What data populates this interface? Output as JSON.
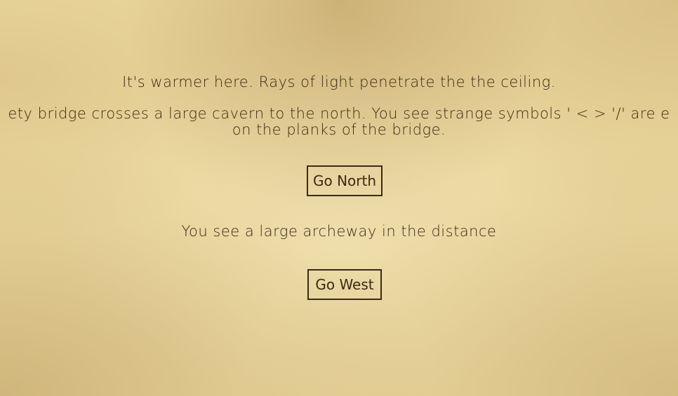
{
  "story": {
    "line1": "It's warmer here. Rays of light penetrate the the ceiling.",
    "line2": "ety bridge crosses a large cavern to the north. You see strange symbols ' < > '/' are e",
    "line3": "on the planks of the bridge.",
    "line4": "You see a large archeway in the distance"
  },
  "buttons": {
    "north": "Go North",
    "west": "Go West"
  },
  "colors": {
    "parchment": "#ecd99f",
    "ink": "#3b2a14"
  }
}
